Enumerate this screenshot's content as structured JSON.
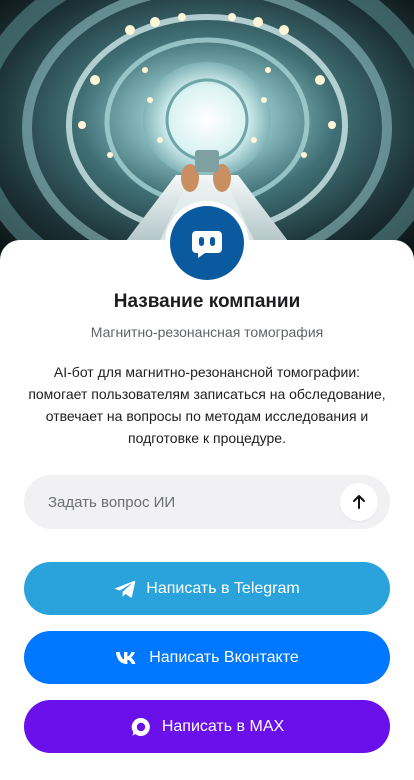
{
  "company": {
    "name": "Название компании",
    "category": "Магнитно-резонансная томография",
    "description": "AI-бот для магнитно-резонансной томографии: помогает пользователям записаться на обследование, отвечает на вопросы по методам исследования и подготовке к процедуре."
  },
  "ask": {
    "placeholder": "Задать вопрос ИИ"
  },
  "buttons": {
    "telegram": "Написать в Telegram",
    "vk": "Написать Вконтакте",
    "max": "Написать в MAX"
  },
  "colors": {
    "telegram": "#2aa3dd",
    "vk": "#0077ff",
    "max": "#6a10ea",
    "avatar": "#0a5aa0"
  },
  "icons": {
    "avatar": "chat-bot-icon",
    "send": "arrow-up-icon",
    "telegram": "telegram-icon",
    "vk": "vk-icon",
    "max": "max-icon"
  }
}
